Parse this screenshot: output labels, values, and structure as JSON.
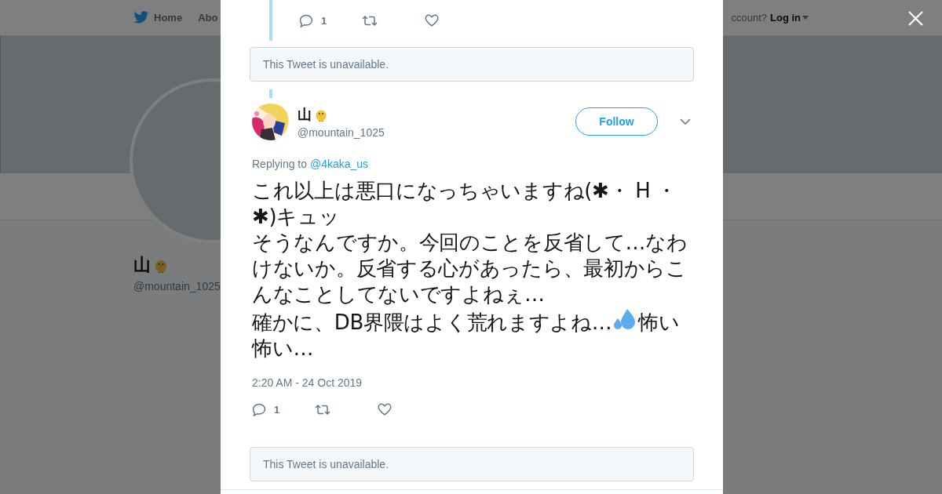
{
  "background_page": {
    "nav": [
      {
        "label": "Home",
        "kind": "home"
      },
      {
        "label": "Abo",
        "kind": "link"
      }
    ],
    "account_prompt": "ccount?",
    "login": "Log in",
    "profile": {
      "name": "山",
      "handle": "@mountain_1025"
    }
  },
  "modal": {
    "thread_actions": {
      "reply_count": "1"
    },
    "unavailable_top": "This Tweet is unavailable.",
    "tweet": {
      "name": "山",
      "handle": "@mountain_1025",
      "follow": "Follow",
      "replying_label": "Replying to",
      "replying_to": "@4kaka_us",
      "body": [
        {
          "kind": "text",
          "text": "これ以上は悪口になっちゃいますね(✱・ H ・✱)キュッ"
        },
        {
          "kind": "break"
        },
        {
          "kind": "text",
          "text": "そうなんですか。今回のことを反省して…なわけないか。反省する心があったら、最初からこんなことしてないですよねぇ…"
        },
        {
          "kind": "break"
        },
        {
          "kind": "text",
          "text": "確かに、DB界隈はよく荒れますよね…"
        },
        {
          "kind": "icon"
        },
        {
          "kind": "text",
          "text": "怖い怖い…"
        }
      ],
      "timestamp": "2:20 AM - 24 Oct 2019",
      "reply_count": "1"
    },
    "unavailable_bottom": "This Tweet is unavailable."
  }
}
